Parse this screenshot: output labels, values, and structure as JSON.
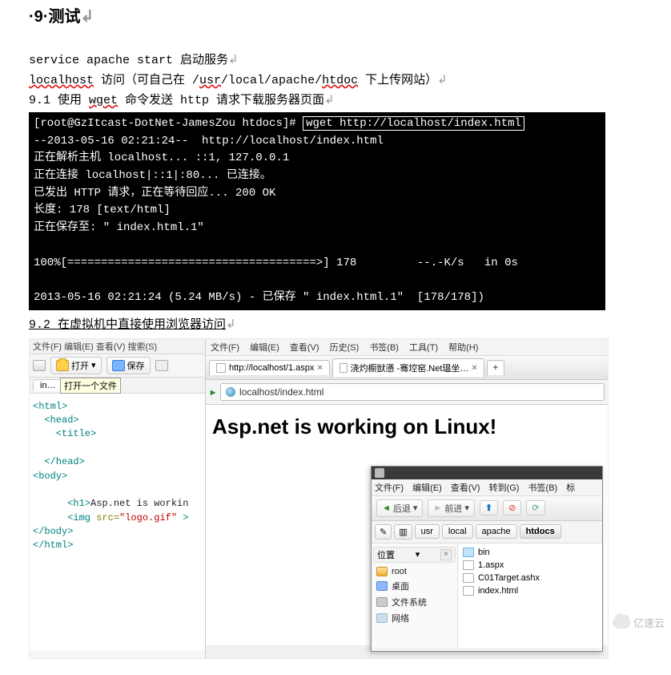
{
  "heading": "·9·测试",
  "lines": {
    "l1_cmd": "service apache start",
    "l1_zh": " 启动服务",
    "l2_host": "localhost",
    "l2_mid": " 访问（可自己在 /",
    "l2_usr": "usr",
    "l2_mid2": "/local/apache/",
    "l2_htdoc": "htdoc",
    "l2_tail": " 下上传网站）",
    "l3_pre": "9.1 使用 ",
    "l3_wget": "wget",
    "l3_post": " 命令发送 http 请求下载服务器页面",
    "l4": "9.2 在虚拟机中直接使用浏览器访问"
  },
  "terminal": {
    "prompt": "[root@GzItcast-DotNet-JamesZou htdocs]#",
    "cmd": "wget http://localhost/index.html",
    "out": "--2013-05-16 02:21:24--  http://localhost/index.html\n正在解析主机 localhost... ::1, 127.0.0.1\n正在连接 localhost|::1|:80... 已连接。\n已发出 HTTP 请求，正在等待回应... 200 OK\n长度: 178 [text/html]\n正在保存至: \" index.html.1\"\n\n100%[=====================================>] 178         --.-K/s   in 0s\n\n2013-05-16 02:21:24 (5.24 MB/s) - 已保存 \" index.html.1\"  [178/178])"
  },
  "editor": {
    "menu": "文件(F)  编辑(E)  查看(V)  搜索(S)",
    "open_label": "打开",
    "save_label": "保存",
    "open_tooltip": "打开一个文件",
    "tab": "in…",
    "code": {
      "l1": "<html>",
      "l2": "  <head>",
      "l3": "    <title>",
      "l4": "",
      "l5": "  </head>",
      "l6": "<body>",
      "l7a": "      <h1>",
      "l7b": "Asp.net is workin",
      "l8a": "      <img ",
      "l8attr": "src=",
      "l8val": "\"logo.gif\"",
      "l8end": " >",
      "l9": "</body>",
      "l10": "</html>"
    }
  },
  "browser": {
    "menu": {
      "file": "文件(F)",
      "edit": "编辑(E)",
      "view": "查看(V)",
      "history": "历史(S)",
      "bookmarks": "书签(B)",
      "tools": "工具(T)",
      "help": "帮助(H)"
    },
    "tabs": {
      "t1": "http://localhost/1.aspx",
      "t2": "浇灼櫉獃懣 -骞埪窑.Net瑥坐…"
    },
    "url": "localhost/index.html",
    "page_h1": "Asp.net is working on Linux!"
  },
  "fm": {
    "menu": {
      "file": "文件(F)",
      "edit": "编辑(E)",
      "view": "查看(V)",
      "go": "转到(G)",
      "bookmarks": "书签(B)",
      "t": "标"
    },
    "nav": {
      "back": "后退",
      "forward": "前进"
    },
    "crumbs": [
      "usr",
      "local",
      "apache",
      "htdocs"
    ],
    "side_header": "位置",
    "places": [
      "root",
      "桌面",
      "文件系统",
      "网络"
    ],
    "files": [
      {
        "name": "bin",
        "type": "folder"
      },
      {
        "name": "1.aspx",
        "type": "file"
      },
      {
        "name": "C01Target.ashx",
        "type": "file"
      },
      {
        "name": "index.html",
        "type": "file"
      }
    ]
  },
  "watermark": "亿速云"
}
